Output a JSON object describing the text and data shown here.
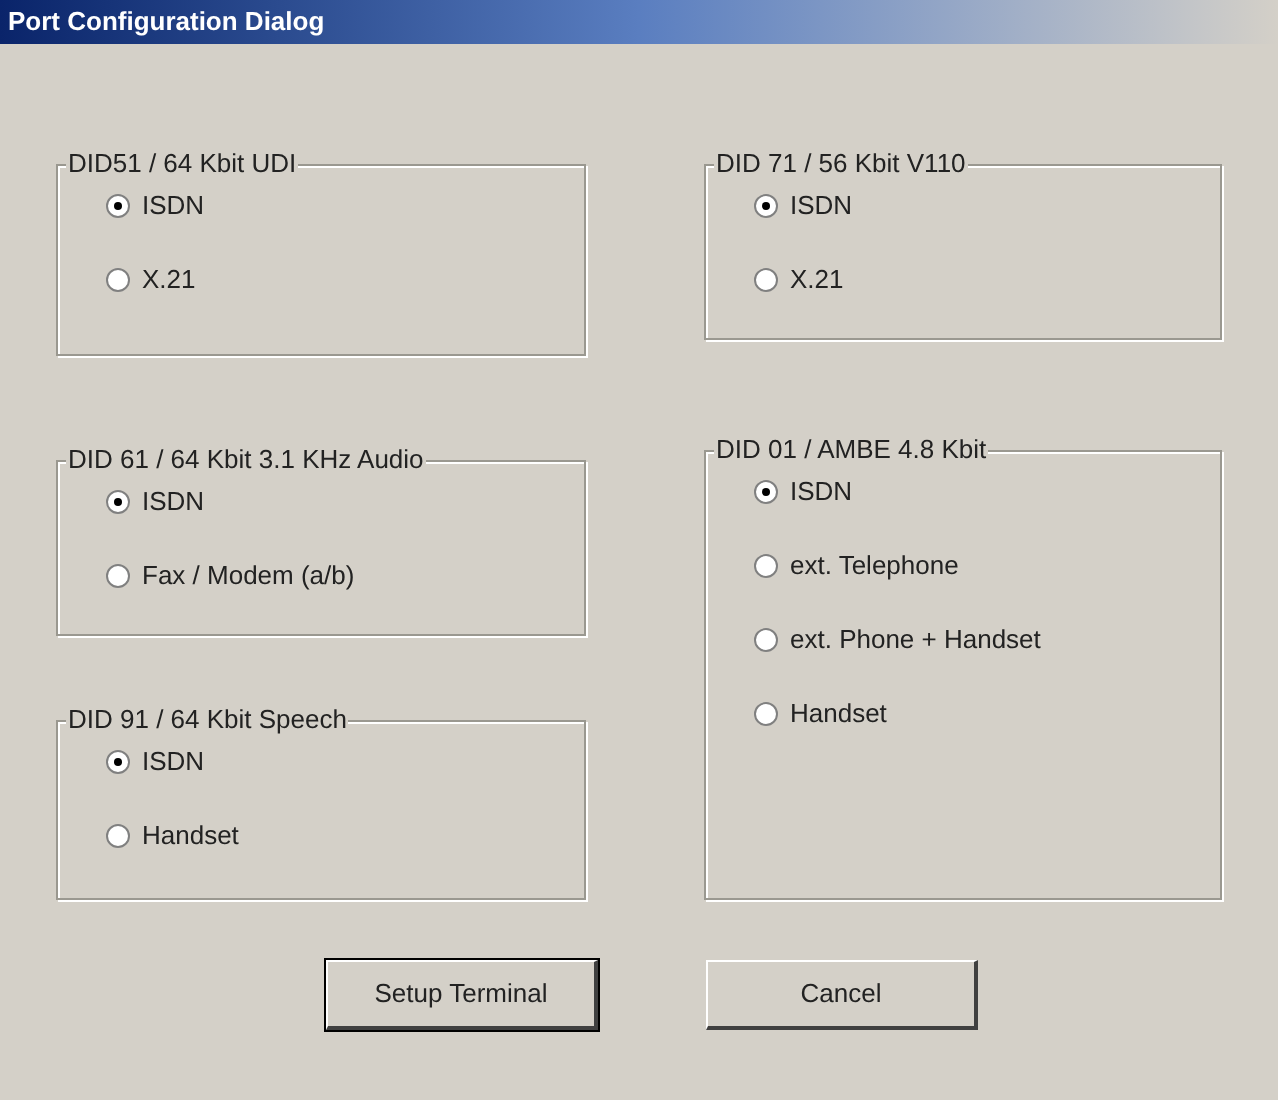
{
  "window": {
    "title": "Port Configuration Dialog"
  },
  "left_column": [
    {
      "title": "DID51 / 64 Kbit UDI",
      "options": [
        {
          "label": "ISDN",
          "selected": true
        },
        {
          "label": "X.21",
          "selected": false
        }
      ]
    },
    {
      "title": "DID 61 / 64 Kbit 3.1 KHz Audio",
      "options": [
        {
          "label": "ISDN",
          "selected": true
        },
        {
          "label": "Fax / Modem (a/b)",
          "selected": false
        }
      ]
    },
    {
      "title": "DID 91 / 64 Kbit Speech",
      "options": [
        {
          "label": "ISDN",
          "selected": true
        },
        {
          "label": "Handset",
          "selected": false
        }
      ]
    }
  ],
  "right_column": [
    {
      "title": "DID 71 / 56 Kbit V110",
      "options": [
        {
          "label": "ISDN",
          "selected": true
        },
        {
          "label": "X.21",
          "selected": false
        }
      ]
    },
    {
      "title": "DID 01 / AMBE 4.8 Kbit",
      "options": [
        {
          "label": "ISDN",
          "selected": true
        },
        {
          "label": "ext. Telephone",
          "selected": false
        },
        {
          "label": "ext. Phone + Handset",
          "selected": false
        },
        {
          "label": "Handset",
          "selected": false
        }
      ]
    }
  ],
  "buttons": [
    {
      "label": "Setup Terminal",
      "default": true
    },
    {
      "label": "Cancel",
      "default": false
    }
  ]
}
